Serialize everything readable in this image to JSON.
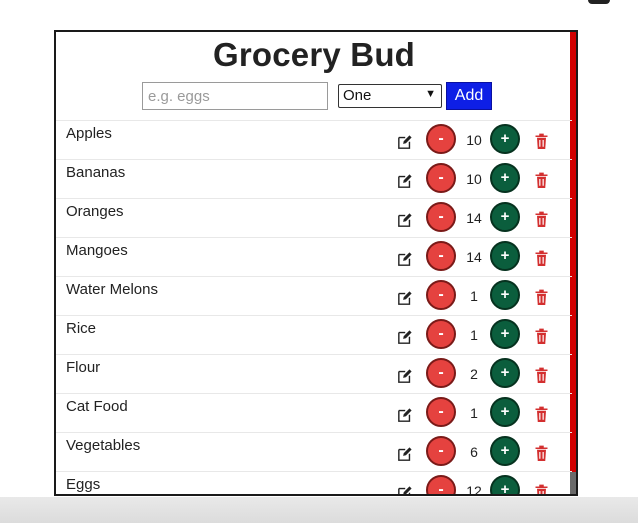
{
  "app": {
    "title": "Grocery Bud"
  },
  "form": {
    "input_placeholder": "e.g. eggs",
    "input_value": "",
    "select_value": "One",
    "add_label": "Add"
  },
  "items": [
    {
      "name": "Apples",
      "quantity": "10"
    },
    {
      "name": "Bananas",
      "quantity": "10"
    },
    {
      "name": "Oranges",
      "quantity": "14"
    },
    {
      "name": "Mangoes",
      "quantity": "14"
    },
    {
      "name": "Water Melons",
      "quantity": "1"
    },
    {
      "name": "Rice",
      "quantity": "1"
    },
    {
      "name": "Flour",
      "quantity": "2"
    },
    {
      "name": "Cat Food",
      "quantity": "1"
    },
    {
      "name": "Vegetables",
      "quantity": "6"
    },
    {
      "name": "Eggs",
      "quantity": "12"
    }
  ],
  "buttons": {
    "minus_label": "-",
    "plus_label": "+"
  },
  "icons": {
    "edit": "edit-icon",
    "trash": "trash-icon"
  },
  "colors": {
    "add_button": "#0e1fe6",
    "minus_button": "#e5423f",
    "plus_button": "#0b5e3d",
    "trash": "#d32f2f",
    "scrollbar": "#d10000"
  }
}
